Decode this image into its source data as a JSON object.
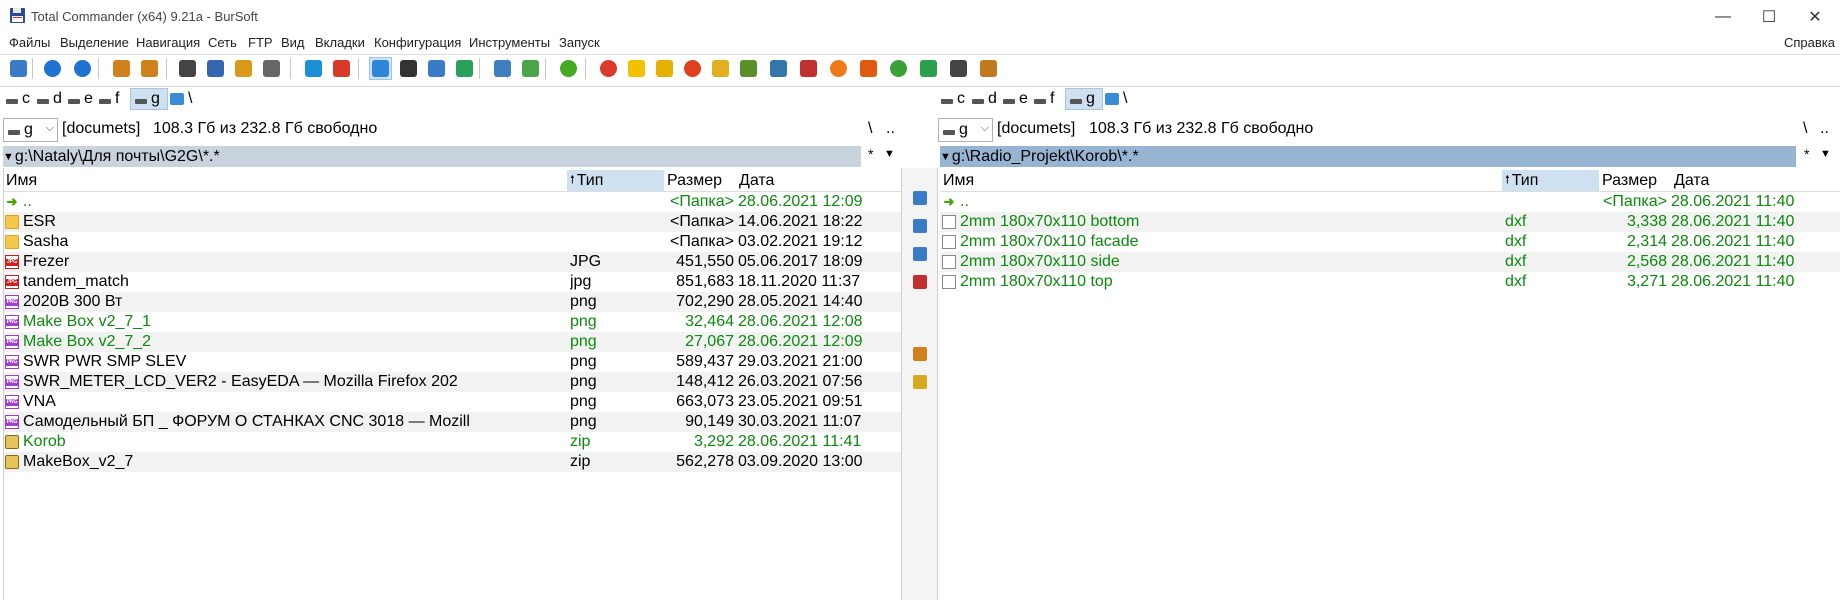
{
  "window": {
    "title": "Total Commander (x64) 9.21a - BurSoft",
    "minimize": "—",
    "maximize": "☐",
    "close": "✕"
  },
  "menu": {
    "items": [
      "Файлы",
      "Выделение",
      "Навигация",
      "Сеть",
      "FTP",
      "Вид",
      "Вкладки",
      "Конфигурация",
      "Инструменты",
      "Запуск"
    ],
    "help": "Справка"
  },
  "toolbar": {
    "icons": [
      "refresh-icon",
      "back-icon",
      "forward-icon",
      "pack-icon",
      "unpack-icon",
      "invert-selection-icon",
      "tree-icon",
      "kb-icon",
      "find-icon",
      "internet-explorer-icon",
      "ftp-icon",
      "info-icon",
      "search-icon",
      "sync-icon",
      "compare-icon",
      "zoom-icon",
      "image-icon",
      "green-circle-icon",
      "chrome-icon",
      "yellow-play-icon",
      "warning-icon",
      "target-icon",
      "ftp-tool-icon",
      "notepad-icon",
      "ink-icon",
      "cable-icon",
      "firefox-icon",
      "mail-icon",
      "utorrent-icon",
      "64-icon",
      "usb-icon",
      "tools-icon"
    ],
    "colors": [
      "#3a7bc8",
      "#1e73d2",
      "#1e73d2",
      "#d0801c",
      "#d0801c",
      "#444444",
      "#3566b0",
      "#d99a1a",
      "#666666",
      "#1b8fd8",
      "#d83a2a",
      "#2f86d9",
      "#333333",
      "#3a7bc8",
      "#2aa05a",
      "#3f7fc0",
      "#4aa44a",
      "#44aa22",
      "#d93a2a",
      "#f2c200",
      "#e6b000",
      "#e04020",
      "#e0b020",
      "#5a8f2a",
      "#3377aa",
      "#c03030",
      "#ef7a1a",
      "#e05a10",
      "#3aa03a",
      "#2aa04a",
      "#444444",
      "#c07a20"
    ]
  },
  "left": {
    "drives": [
      {
        "label": "c",
        "selected": false
      },
      {
        "label": "d",
        "selected": false
      },
      {
        "label": "e",
        "selected": false
      },
      {
        "label": "f",
        "selected": false
      },
      {
        "label": "g",
        "selected": true
      }
    ],
    "net_root": "\\",
    "combo_drive": "g",
    "volume": "[documets]",
    "free_space": "108.3 Гб из 232.8 Гб свободно",
    "root_btn": "\\",
    "up_btn": "..",
    "path": "g:\\Nataly\\Для почты\\G2G\\*.*",
    "filter": "*",
    "columns": {
      "name": "Имя",
      "type": "Тип",
      "size": "Размер",
      "date": "Дата"
    },
    "files": [
      {
        "icon": "up-arrow-icon",
        "name": "..",
        "ext": "",
        "size": "<Папка>",
        "date": "28.06.2021 12:09",
        "green": true
      },
      {
        "icon": "folder-icon",
        "name": "ESR",
        "ext": "",
        "size": "<Папка>",
        "date": "14.06.2021 18:22",
        "green": false
      },
      {
        "icon": "folder-icon",
        "name": "Sasha",
        "ext": "",
        "size": "<Папка>",
        "date": "03.02.2021 19:12",
        "green": false
      },
      {
        "icon": "jpg-file-icon",
        "name": "Frezer",
        "ext": "JPG",
        "size": "451,550",
        "date": "05.06.2017 18:09",
        "green": false
      },
      {
        "icon": "jpg-file-icon",
        "name": "tandem_match",
        "ext": "jpg",
        "size": "851,683",
        "date": "18.11.2020 11:37",
        "green": false
      },
      {
        "icon": "png-file-icon",
        "name": "2020В 300 Вт",
        "ext": "png",
        "size": "702,290",
        "date": "28.05.2021 14:40",
        "green": false
      },
      {
        "icon": "png-file-icon",
        "name": "Make Box v2_7_1",
        "ext": "png",
        "size": "32,464",
        "date": "28.06.2021 12:08",
        "green": true
      },
      {
        "icon": "png-file-icon",
        "name": "Make Box v2_7_2",
        "ext": "png",
        "size": "27,067",
        "date": "28.06.2021 12:09",
        "green": true
      },
      {
        "icon": "png-file-icon",
        "name": "SWR PWR SMP SLEV",
        "ext": "png",
        "size": "589,437",
        "date": "29.03.2021 21:00",
        "green": false
      },
      {
        "icon": "png-file-icon",
        "name": "SWR_METER_LCD_VER2 - EasyEDA — Mozilla Firefox 202",
        "ext": "png",
        "size": "148,412",
        "date": "26.03.2021 07:56",
        "green": false
      },
      {
        "icon": "png-file-icon",
        "name": "VNA",
        "ext": "png",
        "size": "663,073",
        "date": "23.05.2021 09:51",
        "green": false
      },
      {
        "icon": "png-file-icon",
        "name": "Самодельный БП _ ФОРУМ О СТАНКАХ CNC 3018 — Mozill",
        "ext": "png",
        "size": "90,149",
        "date": "30.03.2021 11:07",
        "green": false
      },
      {
        "icon": "zip-file-icon",
        "name": "Korob",
        "ext": "zip",
        "size": "3,292",
        "date": "28.06.2021 11:41",
        "green": true
      },
      {
        "icon": "zip-file-icon",
        "name": "MakeBox_v2_7",
        "ext": "zip",
        "size": "562,278",
        "date": "03.09.2020 13:00",
        "green": false
      }
    ]
  },
  "right": {
    "drives": [
      {
        "label": "c",
        "selected": false
      },
      {
        "label": "d",
        "selected": false
      },
      {
        "label": "e",
        "selected": false
      },
      {
        "label": "f",
        "selected": false
      },
      {
        "label": "g",
        "selected": true
      }
    ],
    "net_root": "\\",
    "combo_drive": "g",
    "volume": "[documets]",
    "free_space": "108.3 Гб из 232.8 Гб свободно",
    "root_btn": "\\",
    "up_btn": "..",
    "path": "g:\\Radio_Projekt\\Korob\\*.*",
    "filter": "*",
    "columns": {
      "name": "Имя",
      "type": "Тип",
      "size": "Размер",
      "date": "Дата"
    },
    "files": [
      {
        "icon": "up-arrow-icon",
        "name": "..",
        "ext": "",
        "size": "<Папка>",
        "date": "28.06.2021 11:40",
        "green": true
      },
      {
        "icon": "document-icon",
        "name": "2mm 180x70x110 bottom",
        "ext": "dxf",
        "size": "3,338",
        "date": "28.06.2021 11:40",
        "green": true
      },
      {
        "icon": "document-icon",
        "name": "2mm 180x70x110 facade",
        "ext": "dxf",
        "size": "2,314",
        "date": "28.06.2021 11:40",
        "green": true
      },
      {
        "icon": "document-icon",
        "name": "2mm 180x70x110 side",
        "ext": "dxf",
        "size": "2,568",
        "date": "28.06.2021 11:40",
        "green": true
      },
      {
        "icon": "document-icon",
        "name": "2mm 180x70x110 top",
        "ext": "dxf",
        "size": "3,271",
        "date": "28.06.2021 11:40",
        "green": true
      }
    ]
  },
  "middle_buttons": {
    "icons": [
      "view-icon",
      "edit-icon",
      "copy-icon",
      "move-icon",
      "pack-files-icon",
      "new-folder-icon"
    ],
    "colors": [
      "#3a7bc8",
      "#3a7bc8",
      "#3a7bc8",
      "#c03030",
      "#d0801c",
      "#d9a620"
    ]
  }
}
